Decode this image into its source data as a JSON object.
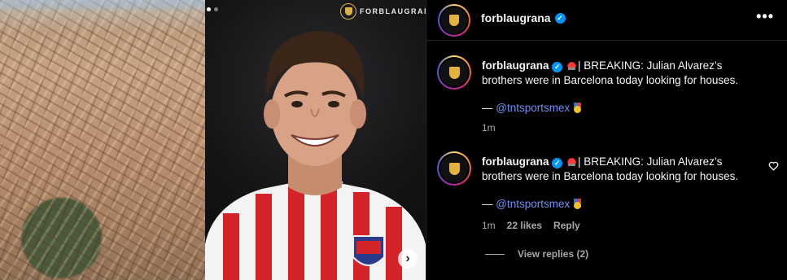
{
  "post": {
    "account": "forblaugrana",
    "watermark": "FORBLAUGRANA",
    "carousel": {
      "count": 2,
      "active_index": 0
    }
  },
  "comments": [
    {
      "username": "forblaugrana",
      "body": "| BREAKING: Julian Alvarez’s brothers were in Barcelona today looking for houses.",
      "source_prefix": "— ",
      "mention": "@tntsportsmex",
      "time": "1m"
    },
    {
      "username": "forblaugrana",
      "body": "| BREAKING: Julian Alvarez’s brothers were in Barcelona today looking for houses.",
      "source_prefix": "— ",
      "mention": "@tntsportsmex",
      "time": "1m",
      "likes": "22 likes",
      "reply_label": "Reply",
      "view_replies": "View replies (2)"
    }
  ],
  "icons": {
    "verified": "verified-badge-icon",
    "more": "more-options-icon",
    "siren": "siren-emoji",
    "medal": "medal-emoji",
    "heart": "heart-outline-icon",
    "next": "chevron-right-icon"
  },
  "colors": {
    "background": "#000000",
    "text": "#f5f5f5",
    "muted": "#a8a8a8",
    "mention": "#6f8ff5",
    "verified": "#0095f6"
  }
}
